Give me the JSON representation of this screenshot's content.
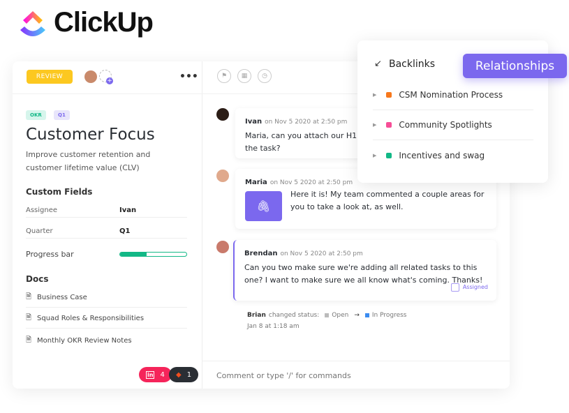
{
  "brand": {
    "name": "ClickUp"
  },
  "task": {
    "status": "REVIEW",
    "tags": [
      "OKR",
      "Q1"
    ],
    "title": "Customer Focus",
    "description": "Improve customer retention and customer lifetime value (CLV)"
  },
  "custom_fields": {
    "heading": "Custom Fields",
    "fields": [
      {
        "label": "Assignee",
        "value": "Ivan"
      },
      {
        "label": "Quarter",
        "value": "Q1"
      },
      {
        "label": "Progress bar",
        "progress": 0.4
      }
    ]
  },
  "docs": {
    "heading": "Docs",
    "items": [
      "Business Case",
      "Squad Roles & Responsibilities",
      "Monthly OKR Review Notes"
    ]
  },
  "integrations": [
    {
      "icon": "linkedin-icon",
      "count": "4",
      "color": "#f5245a"
    },
    {
      "icon": "figma-icon",
      "count": "1",
      "color": "#2a2e34"
    }
  ],
  "comments": [
    {
      "author": "Ivan",
      "time": "on Nov 5 2020 at 2:50 pm",
      "text": "Maria, can you attach our H1 Pl the task?"
    },
    {
      "author": "Maria",
      "time": "on Nov 5 2020 at 2:50 pm",
      "text": "Here it is! My team commented a couple areas for you to take a look at, as well."
    },
    {
      "author": "Brendan",
      "time": "on Nov 5 2020 at 2:50 pm",
      "text": "Can you two make sure we're adding all related tasks to this one? I want to make sure we all know what's coming. Thanks!",
      "action": "Assigned"
    }
  ],
  "activity": {
    "user": "Brian",
    "action": "changed status:",
    "from": "Open",
    "to": "In Progress",
    "time": "Jan 8 at 1:18 am"
  },
  "comment_input": {
    "placeholder": "Comment or type '/' for commands"
  },
  "backlinks": {
    "heading": "Backlinks",
    "items": [
      {
        "label": "CSM Nomination Process",
        "color": "#f7781c"
      },
      {
        "label": "Community Spotlights",
        "color": "#f64e97"
      },
      {
        "label": "Incentives and swag",
        "color": "#12b886"
      }
    ]
  },
  "relationships_label": "Relationships",
  "colors": {
    "accent": "#7b68ee",
    "review": "#fcc820",
    "progress": "#12b886"
  }
}
